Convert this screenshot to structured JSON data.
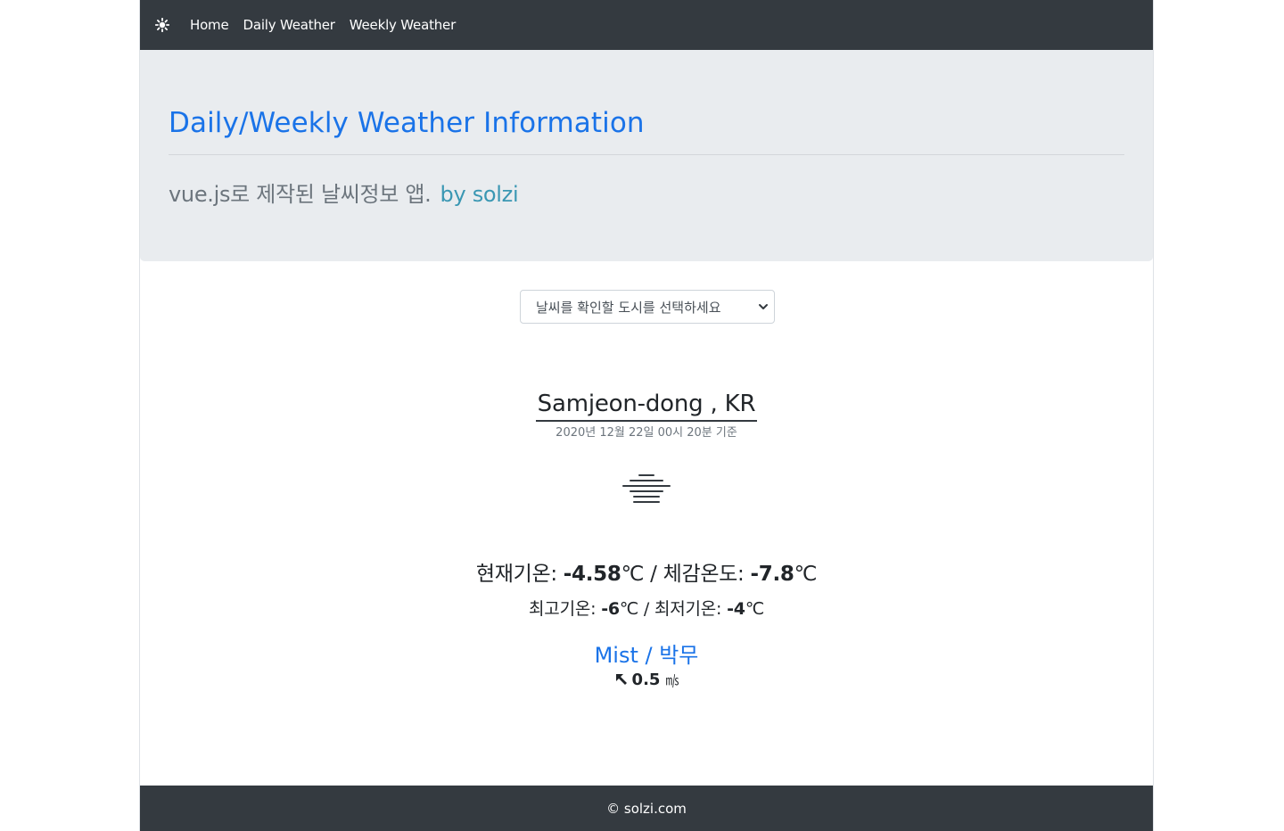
{
  "navbar": {
    "brand_icon": "sun-icon",
    "links": [
      {
        "label": "Home"
      },
      {
        "label": "Daily Weather"
      },
      {
        "label": "Weekly Weather"
      }
    ]
  },
  "jumbotron": {
    "title": "Daily/Weekly Weather Information",
    "lead": "vue.js로 제작된 날씨정보 앱.",
    "author": "by solzi"
  },
  "city_select": {
    "selected": "날씨를 확인할 도시를 선택하세요"
  },
  "weather": {
    "city": "Samjeon-dong , KR",
    "timestamp": "2020년 12월 22일 00시 20분 기준",
    "icon": "mist-icon",
    "current_label": "현재기온: ",
    "current_temp": "-4.58",
    "feels_label": "체감온도: ",
    "feels_temp": "-7.8",
    "unit": "℃",
    "max_label": "최고기온: ",
    "max_temp": "-6",
    "min_label": "최저기온: ",
    "min_temp": "-4",
    "description": "Mist / 박무",
    "wind_speed": "0.5",
    "wind_unit": "㎧",
    "wind_icon": "arrow-up-left-icon"
  },
  "footer": {
    "text": "© solzi.com"
  },
  "colors": {
    "navbar_bg": "#343a40",
    "jumbotron_bg": "#e9ecef",
    "title_blue": "#1a73e8",
    "author_teal": "#3a97b3"
  }
}
